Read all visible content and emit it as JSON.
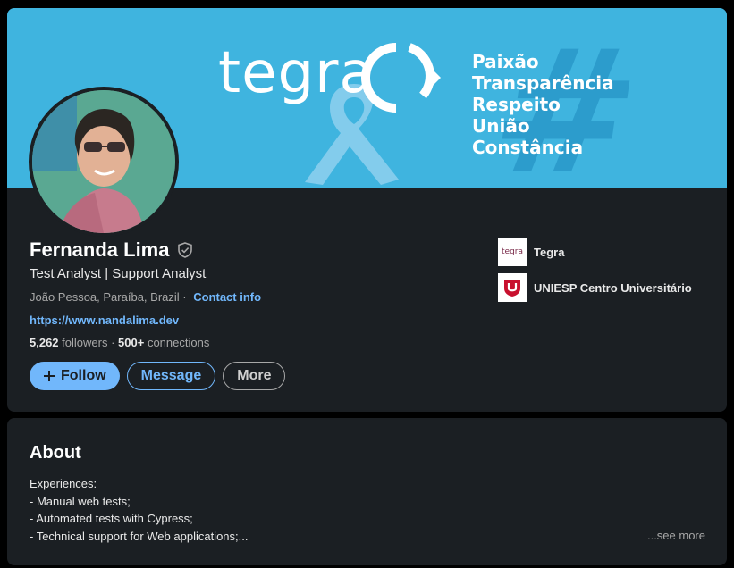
{
  "banner": {
    "logo_text": "tegra",
    "values": [
      "Paixão",
      "Transparência",
      "Respeito",
      "União",
      "Constância"
    ]
  },
  "profile": {
    "name": "Fernanda Lima",
    "headline": "Test Analyst | Support Analyst",
    "location": "João Pessoa, Paraíba, Brazil",
    "location_separator": " · ",
    "contact_info_label": "Contact info",
    "website": "https://www.nandalima.dev",
    "followers_count": "5,262",
    "followers_label": " followers",
    "connections_separator": " · ",
    "connections_count": "500+",
    "connections_label": " connections"
  },
  "actions": {
    "follow_label": "Follow",
    "message_label": "Message",
    "more_label": "More"
  },
  "organizations": [
    {
      "name": "Tegra",
      "logo_text": "tegra",
      "icon": "tegra-logo-icon"
    },
    {
      "name": "UNIESP Centro Universitário",
      "icon": "uniesp-logo-icon"
    }
  ],
  "about": {
    "title": "About",
    "lines": [
      "Experiences:",
      "- Manual web tests;",
      "- Automated tests with Cypress;",
      "- Technical support for Web applications;..."
    ],
    "see_more_label": "...see more"
  },
  "colors": {
    "page_bg": "#000000",
    "card_bg": "#1b1f23",
    "accent": "#71b7fb",
    "banner_bg": "#3fb4df",
    "muted_text": "#a8a8a8"
  }
}
